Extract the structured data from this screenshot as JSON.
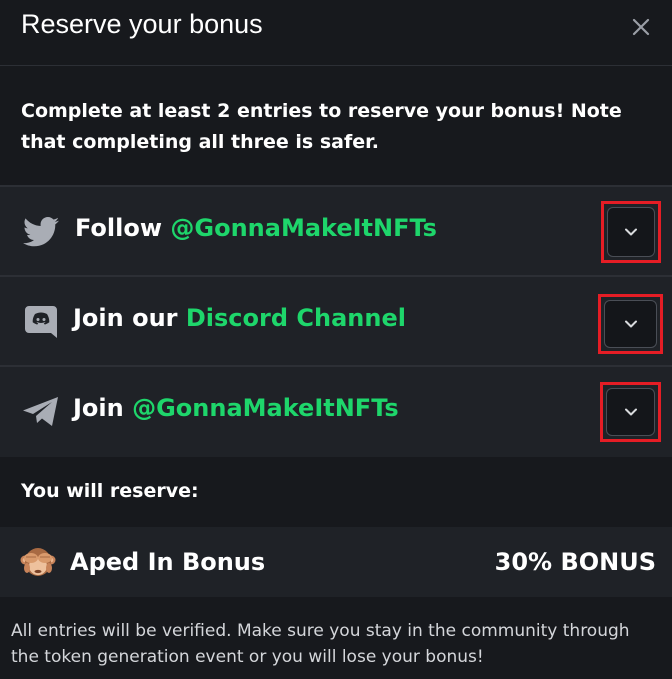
{
  "modal": {
    "title": "Reserve your bonus",
    "close_icon": "close-icon",
    "intro": "Complete at least 2 entries to reserve your bonus! Note that completing all three is safer."
  },
  "entries": [
    {
      "icon": "twitter-icon",
      "prefix": "Follow ",
      "accent": "@GonnaMakeItNFTs"
    },
    {
      "icon": "discord-icon",
      "prefix": "Join our ",
      "accent": "Discord Channel"
    },
    {
      "icon": "telegram-icon",
      "prefix": "Join ",
      "accent": "@GonnaMakeItNFTs"
    }
  ],
  "reserve": {
    "label": "You will reserve:",
    "bonus_name": "Aped In Bonus",
    "bonus_value": "30% BONUS",
    "icon": "see-no-evil-monkey-icon"
  },
  "footer": {
    "text": "All entries will be verified. Make sure you stay in the community through the token generation event or you will lose your bonus!"
  },
  "colors": {
    "background": "#17191d",
    "row_background": "#1f2227",
    "accent": "#1ed66b",
    "highlight": "#e51d25"
  }
}
